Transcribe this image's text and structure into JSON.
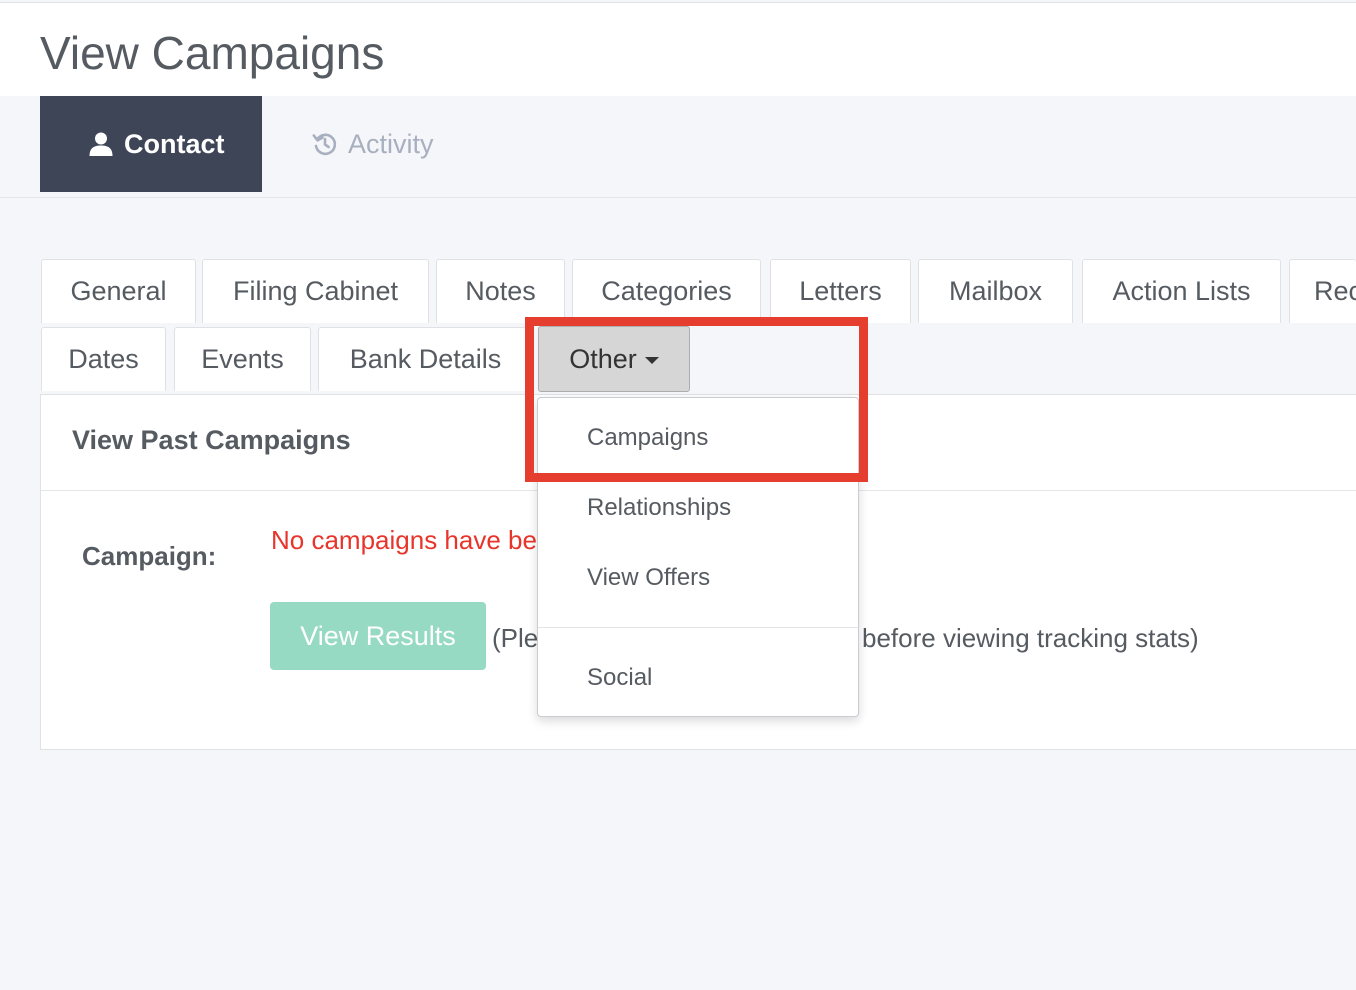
{
  "page": {
    "title": "View Campaigns"
  },
  "main_tabs": [
    {
      "label": "Contact",
      "icon": "user-icon",
      "active": true
    },
    {
      "label": "Activity",
      "icon": "history-icon",
      "active": false
    }
  ],
  "sub_tabs_row1": [
    "General",
    "Filing Cabinet",
    "Notes",
    "Categories",
    "Letters",
    "Mailbox",
    "Action Lists",
    "Rec"
  ],
  "sub_tabs_row2": [
    "Dates",
    "Events",
    "Bank Details"
  ],
  "other_tab": {
    "label": "Other",
    "icon": "caret-down-icon"
  },
  "dropdown": {
    "items": [
      "Campaigns",
      "Relationships",
      "View Offers"
    ],
    "items_after_divider": [
      "Social"
    ]
  },
  "panel": {
    "title": "View Past Campaigns",
    "campaign_label": "Campaign:",
    "error": "No campaigns have be",
    "button": "View Results",
    "hint_left": "(Ple",
    "hint_right": "before viewing tracking stats)"
  },
  "colors": {
    "active_tab_bg": "#3d4556",
    "error_text": "#e8352b",
    "button_bg": "#96dac4",
    "highlight_border": "#e53d2e"
  }
}
